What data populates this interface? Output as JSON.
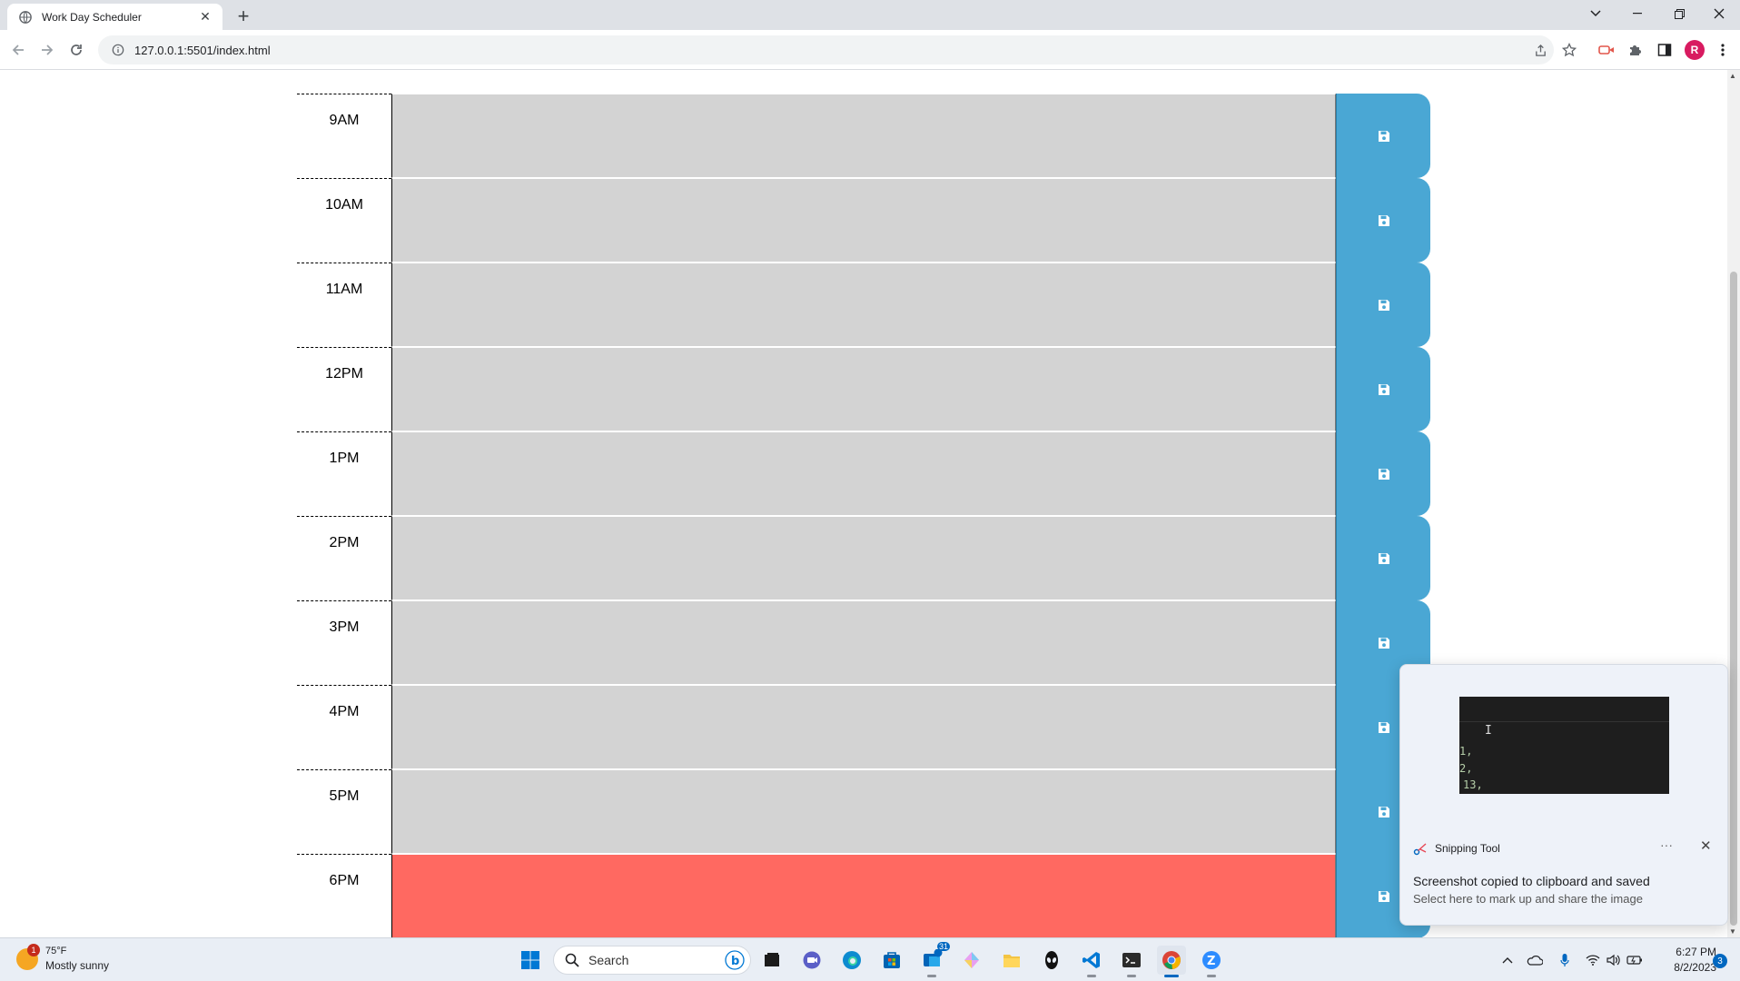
{
  "browser": {
    "tab_title": "Work Day Scheduler",
    "tab_close": "✕",
    "new_tab": "+",
    "url": "127.0.0.1:5501/index.html",
    "profile_initial": "R"
  },
  "scheduler": {
    "rows": [
      {
        "hour": "9AM",
        "state": "past",
        "text": ""
      },
      {
        "hour": "10AM",
        "state": "past",
        "text": ""
      },
      {
        "hour": "11AM",
        "state": "past",
        "text": ""
      },
      {
        "hour": "12PM",
        "state": "past",
        "text": ""
      },
      {
        "hour": "1PM",
        "state": "past",
        "text": ""
      },
      {
        "hour": "2PM",
        "state": "past",
        "text": ""
      },
      {
        "hour": "3PM",
        "state": "past",
        "text": ""
      },
      {
        "hour": "4PM",
        "state": "past",
        "text": ""
      },
      {
        "hour": "5PM",
        "state": "past",
        "text": ""
      },
      {
        "hour": "6PM",
        "state": "present",
        "text": ""
      }
    ],
    "colors": {
      "past": "#d3d3d3",
      "present": "#ff6961",
      "future": "#77dd77",
      "save": "#4aa7d4"
    }
  },
  "toast": {
    "app_name": "Snipping Tool",
    "title": "Screenshot copied to clipboard and saved",
    "subtitle": "Select here to mark up and share the image",
    "more": "···",
    "close": "✕",
    "preview_lines": [
      "1,",
      "2,",
      "13,"
    ]
  },
  "taskbar": {
    "weather_temp": "75°F",
    "weather_condition": "Mostly sunny",
    "weather_badge": "1",
    "search_label": "Search",
    "teams_badge": "31",
    "time": "6:27 PM",
    "date": "8/2/2023",
    "notification_count": "3"
  }
}
